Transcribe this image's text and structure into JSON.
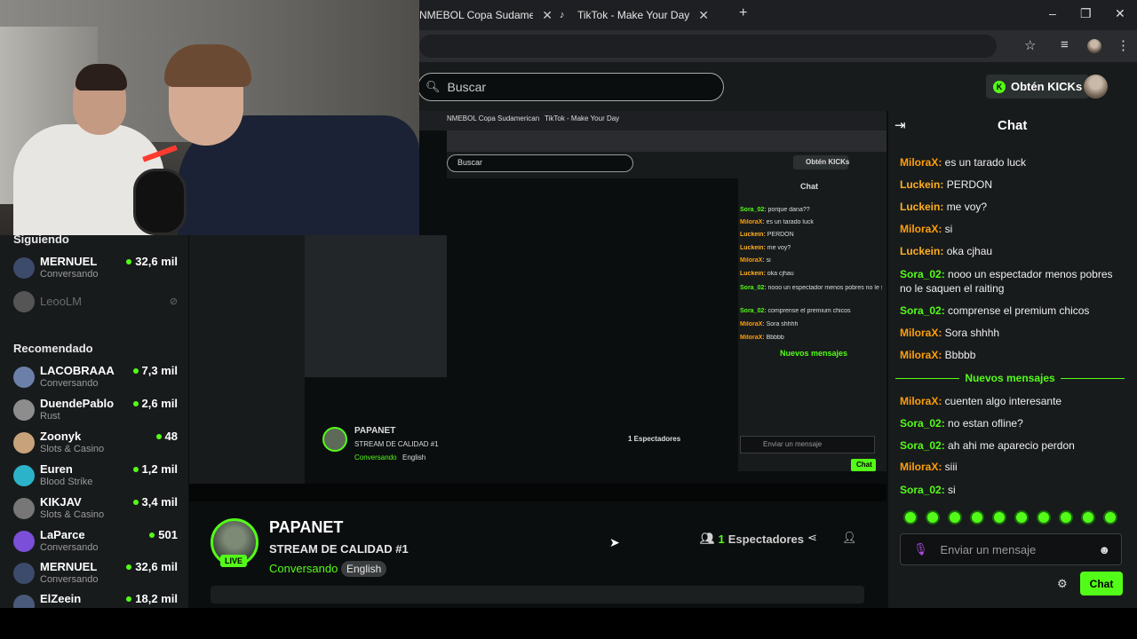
{
  "browser": {
    "tabs": [
      {
        "label": "NMEBOL Copa Sudamerican",
        "close": "✕"
      },
      {
        "label": "TikTok - Make Your Day",
        "close": "✕"
      }
    ],
    "new_tab": "+",
    "window_controls": [
      "–",
      "❐",
      "✕"
    ]
  },
  "header": {
    "search_placeholder": "Buscar",
    "kicks_button": "Obtén KICKs"
  },
  "sidebar": {
    "following_title": "Siguiendo",
    "following": [
      {
        "name": "MERNUEL",
        "category": "Conversando",
        "viewers": "32,6 mil"
      },
      {
        "name": "LeooLM",
        "offline": true
      }
    ],
    "recommended_title": "Recomendado",
    "recommended": [
      {
        "name": "LACOBRAAA",
        "category": "Conversando",
        "viewers": "7,3 mil"
      },
      {
        "name": "DuendePablo",
        "category": "Rust",
        "viewers": "2,6 mil"
      },
      {
        "name": "Zoonyk",
        "category": "Slots & Casino",
        "viewers": "48"
      },
      {
        "name": "Euren",
        "category": "Blood Strike",
        "viewers": "1,2 mil"
      },
      {
        "name": "KIKJAV",
        "category": "Slots & Casino",
        "viewers": "3,4 mil"
      },
      {
        "name": "LaParce",
        "category": "Conversando",
        "viewers": "501"
      },
      {
        "name": "MERNUEL",
        "category": "Conversando",
        "viewers": "32,6 mil"
      },
      {
        "name": "ElZeein",
        "category": "",
        "viewers": "18,2 mil"
      }
    ]
  },
  "stream": {
    "username": "PAPANET",
    "title": "STREAM DE CALIDAD #1",
    "category": "Conversando",
    "language": "English",
    "live_label": "LIVE",
    "viewers_count": "1",
    "viewers_label": "Espectadores"
  },
  "nested": {
    "tab1": "NMEBOL Copa Sudamerican",
    "tab2": "TikTok - Make Your Day",
    "search": "Buscar",
    "kicks": "Obtén KICKs",
    "chat_title": "Chat",
    "username": "PAPANET",
    "title": "STREAM DE CALIDAD #1",
    "category": "Conversando",
    "language": "English",
    "viewers": "1 Espectadores",
    "input": "Enviar un mensaje",
    "send": "Chat",
    "messages": [
      {
        "u": "Sora_02",
        "t": "porque dana??",
        "c": "#53fc18"
      },
      {
        "u": "MiloraX",
        "t": "es un tarado luck",
        "c": "#ff9f0a"
      },
      {
        "u": "Luckein",
        "t": "PERDON",
        "c": "#ffb020"
      },
      {
        "u": "Luckein",
        "t": "me voy?",
        "c": "#ffb020"
      },
      {
        "u": "MiloraX",
        "t": "si",
        "c": "#ff9f0a"
      },
      {
        "u": "Luckein",
        "t": "oka cjhau",
        "c": "#ffb020"
      },
      {
        "u": "Sora_02",
        "t": "nooo un espectador menos pobres no le saquen el raiting",
        "c": "#53fc18"
      },
      {
        "u": "Sora_02",
        "t": "comprense el premium chicos",
        "c": "#53fc18"
      },
      {
        "u": "MiloraX",
        "t": "Sora shhhh",
        "c": "#ff9f0a"
      },
      {
        "u": "MiloraX",
        "t": "Bbbbb",
        "c": "#ff9f0a"
      }
    ],
    "new_messages": "Nuevos mensajes"
  },
  "chat": {
    "title": "Chat",
    "messages_before": [
      {
        "user": "MiloraX",
        "text": "es un tarado luck",
        "color": "#ff9f0a"
      },
      {
        "user": "Luckein",
        "text": "PERDON",
        "color": "#ffb020"
      },
      {
        "user": "Luckein",
        "text": "me voy?",
        "color": "#ffb020"
      },
      {
        "user": "MiloraX",
        "text": "si",
        "color": "#ff9f0a"
      },
      {
        "user": "Luckein",
        "text": "oka cjhau",
        "color": "#ffb020"
      },
      {
        "user": "Sora_02",
        "text": "nooo un espectador menos pobres no le saquen el raiting",
        "color": "#53fc18"
      },
      {
        "user": "Sora_02",
        "text": "comprense el premium chicos",
        "color": "#53fc18"
      },
      {
        "user": "MiloraX",
        "text": "Sora shhhh",
        "color": "#ff9f0a"
      },
      {
        "user": "MiloraX",
        "text": "Bbbbb",
        "color": "#ff9f0a"
      }
    ],
    "new_messages_label": "Nuevos mensajes",
    "messages_after": [
      {
        "user": "MiloraX",
        "text": "cuenten algo interesante",
        "color": "#ff9f0a"
      },
      {
        "user": "Sora_02",
        "text": "no estan ofline?",
        "color": "#53fc18"
      },
      {
        "user": "Sora_02",
        "text": "ah ahi me aparecio perdon",
        "color": "#53fc18"
      },
      {
        "user": "MiloraX",
        "text": "siii",
        "color": "#ff9f0a"
      },
      {
        "user": "Sora_02",
        "text": "si",
        "color": "#53fc18"
      }
    ],
    "input_placeholder": "Enviar un mensaje",
    "send_label": "Chat"
  },
  "colors": {
    "accent": "#53fc18",
    "background": "#0b0e0f",
    "panel": "#181b1c"
  },
  "icons": {
    "search": "search-icon",
    "star": "star-icon",
    "chat_collapse": "collapse-icon",
    "share": "share-icon",
    "follow": "follow-icon",
    "mic": "mic-icon",
    "emoji": "emoji-icon",
    "settings": "gear-icon"
  }
}
